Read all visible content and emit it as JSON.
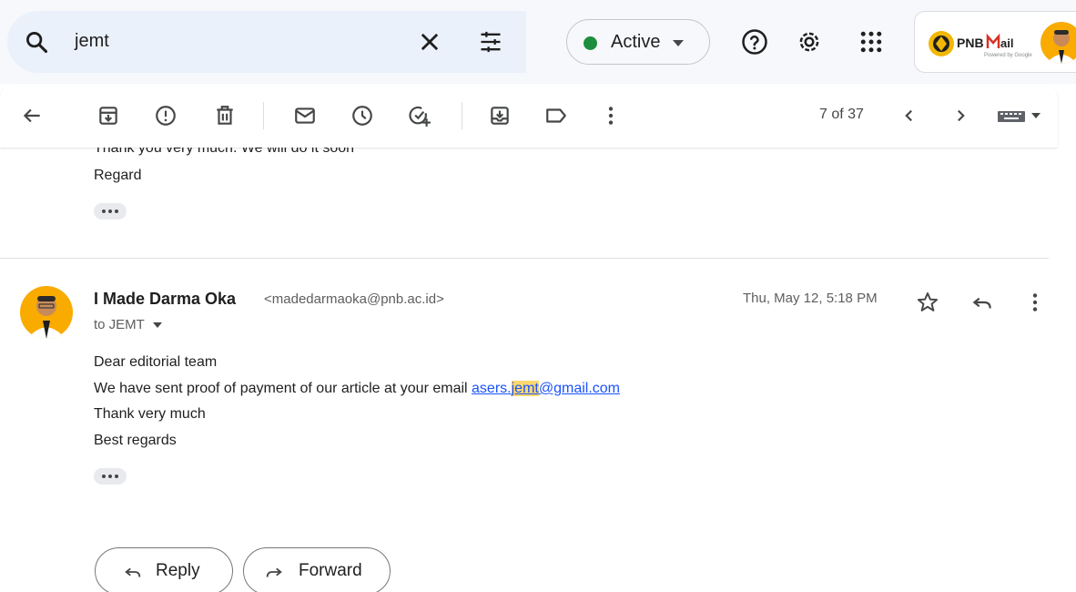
{
  "search": {
    "query": "jemt"
  },
  "status": {
    "label": "Active",
    "color": "#1e8e3e"
  },
  "account": {
    "logo_text": "PNBMail",
    "logo_sub": "Powered by Google"
  },
  "toolbar": {
    "pager": "7 of 37"
  },
  "previous_message": {
    "lines": [
      "Thank you very much. We will do it soon",
      "Regard"
    ]
  },
  "message": {
    "sender_name": "I Made Darma Oka",
    "sender_email": "<madedarmaoka@pnb.ac.id>",
    "recipient": "to JEMT",
    "date": "Thu, May 12, 5:18 PM",
    "greeting": "Dear editorial team",
    "body_prefix": "We have sent proof of payment of our article at your email ",
    "link_part1": "asers.",
    "link_highlight": "jemt",
    "link_part2": "@gmail.com",
    "line3": "Thank very much",
    "line4": "Best regards"
  },
  "actions": {
    "reply_label": "Reply",
    "forward_label": "Forward"
  },
  "colors": {
    "accent": "#1a53ff",
    "highlight": "#fcd86f",
    "avatar_bg": "#f9ab00"
  },
  "icons": [
    "search-icon",
    "close-icon",
    "tune-icon",
    "help-icon",
    "settings-icon",
    "apps-icon",
    "back-icon",
    "archive-icon",
    "report-spam-icon",
    "delete-icon",
    "mark-unread-icon",
    "snooze-icon",
    "add-task-icon",
    "move-to-icon",
    "label-icon",
    "more-icon",
    "prev-icon",
    "next-icon",
    "keyboard-icon",
    "star-icon",
    "reply-icon",
    "forward-icon"
  ]
}
